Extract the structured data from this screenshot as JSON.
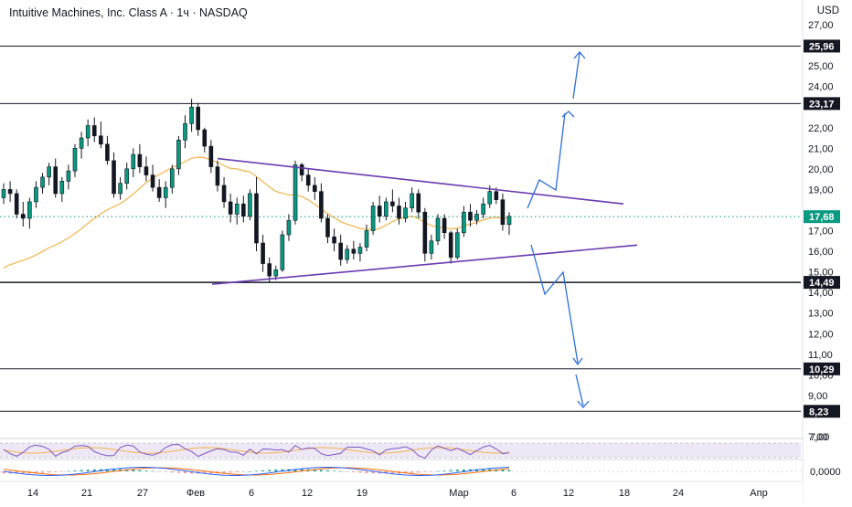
{
  "header": {
    "title": "Intuitive Machines, Inc. Class A · 1ч · NASDAQ",
    "currency": "USD"
  },
  "chart_data": {
    "type": "candlestick",
    "y_axis": {
      "range": [
        6.9,
        27.4
      ],
      "ticks": [
        "27,00",
        "25,00",
        "24,00",
        "22,00",
        "21,00",
        "20,00",
        "19,00",
        "17,00",
        "16,00",
        "15,00",
        "14,00",
        "13,00",
        "12,00",
        "11,00",
        "10,00",
        "9,00",
        "7,00"
      ],
      "tick_values": [
        27,
        25,
        24,
        22,
        21,
        20,
        19,
        17,
        16,
        15,
        14,
        13,
        12,
        11,
        10,
        9,
        7
      ]
    },
    "x_axis": {
      "labels": [
        "14",
        "21",
        "27",
        "Фев",
        "6",
        "12",
        "19",
        "Мар",
        "6",
        "12",
        "18",
        "24",
        "Апр"
      ]
    },
    "levels": [
      {
        "value": 25.96,
        "label": "25,96"
      },
      {
        "value": 23.17,
        "label": "23,17"
      },
      {
        "value": 14.49,
        "label": "14,49"
      },
      {
        "value": 10.29,
        "label": "10,29"
      },
      {
        "value": 8.23,
        "label": "8,23"
      }
    ],
    "last_price": {
      "value": 17.68,
      "label": "17,68",
      "color": "#089981"
    },
    "triangle": {
      "upper": [
        [
          0.0,
          20.5
        ],
        [
          1.0,
          18.3
        ]
      ],
      "lower": [
        [
          0.0,
          14.4
        ],
        [
          1.0,
          16.3
        ]
      ],
      "color": "#6a3ab0"
    },
    "scenarios": {
      "bullish": [
        [
          17.9
        ],
        [
          19.4
        ],
        [
          19.0
        ],
        [
          22.8
        ],
        [
          25.6
        ]
      ],
      "bearish": [
        [
          16.3
        ],
        [
          14.0
        ],
        [
          14.9
        ],
        [
          10.4
        ],
        [
          8.4
        ]
      ],
      "color": "#2d6fd8"
    },
    "moving_average_color": "#f2b449",
    "candles": [
      [
        18.6,
        19.3,
        18.3,
        19.0
      ],
      [
        19.0,
        19.4,
        18.4,
        18.8
      ],
      [
        18.8,
        19.0,
        17.6,
        17.8
      ],
      [
        17.8,
        18.4,
        17.2,
        17.6
      ],
      [
        17.6,
        18.6,
        17.1,
        18.4
      ],
      [
        18.4,
        19.4,
        18.1,
        19.1
      ],
      [
        19.1,
        19.8,
        18.8,
        19.6
      ],
      [
        19.6,
        20.3,
        19.2,
        20.1
      ],
      [
        20.1,
        20.5,
        18.6,
        18.8
      ],
      [
        18.8,
        19.6,
        18.4,
        19.4
      ],
      [
        19.4,
        20.2,
        19.0,
        19.9
      ],
      [
        19.9,
        21.2,
        19.6,
        21.0
      ],
      [
        21.0,
        21.8,
        20.5,
        21.5
      ],
      [
        21.5,
        22.4,
        21.1,
        22.1
      ],
      [
        22.1,
        22.5,
        21.3,
        21.6
      ],
      [
        21.6,
        22.3,
        21.0,
        21.2
      ],
      [
        21.2,
        21.6,
        20.2,
        20.4
      ],
      [
        20.4,
        20.8,
        18.6,
        18.8
      ],
      [
        18.8,
        19.6,
        18.5,
        19.3
      ],
      [
        19.3,
        20.3,
        19.0,
        20.0
      ],
      [
        20.0,
        21.0,
        19.6,
        20.7
      ],
      [
        20.7,
        21.2,
        19.8,
        20.1
      ],
      [
        20.1,
        20.6,
        19.4,
        19.7
      ],
      [
        19.7,
        20.2,
        18.9,
        19.1
      ],
      [
        19.1,
        19.5,
        18.4,
        18.6
      ],
      [
        18.6,
        19.4,
        18.1,
        19.1
      ],
      [
        19.1,
        20.2,
        18.8,
        20.0
      ],
      [
        20.0,
        21.6,
        19.7,
        21.4
      ],
      [
        21.4,
        22.6,
        21.0,
        22.2
      ],
      [
        22.2,
        23.4,
        21.8,
        23.0
      ],
      [
        23.0,
        23.2,
        21.6,
        21.9
      ],
      [
        21.9,
        22.0,
        20.8,
        21.1
      ],
      [
        21.1,
        21.4,
        19.8,
        20.1
      ],
      [
        20.1,
        20.4,
        18.9,
        19.2
      ],
      [
        19.2,
        19.6,
        18.1,
        18.4
      ],
      [
        18.4,
        18.8,
        17.4,
        17.8
      ],
      [
        17.8,
        18.6,
        17.3,
        18.3
      ],
      [
        18.3,
        18.7,
        17.4,
        17.7
      ],
      [
        17.7,
        19.0,
        17.5,
        18.8
      ],
      [
        18.8,
        19.6,
        16.0,
        16.4
      ],
      [
        16.4,
        16.8,
        15.0,
        15.4
      ],
      [
        15.4,
        15.7,
        14.5,
        14.8
      ],
      [
        14.8,
        15.3,
        14.6,
        15.1
      ],
      [
        15.1,
        17.0,
        15.0,
        16.8
      ],
      [
        16.8,
        17.8,
        16.5,
        17.5
      ],
      [
        17.5,
        20.4,
        17.3,
        20.2
      ],
      [
        20.2,
        20.3,
        19.4,
        19.7
      ],
      [
        19.7,
        20.0,
        18.9,
        19.2
      ],
      [
        19.2,
        19.6,
        18.5,
        18.9
      ],
      [
        18.9,
        19.3,
        17.4,
        17.6
      ],
      [
        17.6,
        17.8,
        16.4,
        16.7
      ],
      [
        16.7,
        17.1,
        16.0,
        16.4
      ],
      [
        16.4,
        16.8,
        15.3,
        15.6
      ],
      [
        15.6,
        16.3,
        15.4,
        16.1
      ],
      [
        16.1,
        16.5,
        15.6,
        15.9
      ],
      [
        15.9,
        16.4,
        15.5,
        16.2
      ],
      [
        16.2,
        17.3,
        16.0,
        17.0
      ],
      [
        17.0,
        18.4,
        16.8,
        18.2
      ],
      [
        18.2,
        18.7,
        17.4,
        17.7
      ],
      [
        17.7,
        18.6,
        17.5,
        18.4
      ],
      [
        18.4,
        19.0,
        17.9,
        18.2
      ],
      [
        18.2,
        18.6,
        17.3,
        17.6
      ],
      [
        17.6,
        18.4,
        17.4,
        18.1
      ],
      [
        18.1,
        19.1,
        17.9,
        18.8
      ],
      [
        18.8,
        19.0,
        17.6,
        17.9
      ],
      [
        17.9,
        18.1,
        15.5,
        15.9
      ],
      [
        15.9,
        16.8,
        15.6,
        16.5
      ],
      [
        16.5,
        17.8,
        16.3,
        17.6
      ],
      [
        17.6,
        17.8,
        16.6,
        16.9
      ],
      [
        16.9,
        17.0,
        15.4,
        15.7
      ],
      [
        15.7,
        17.1,
        15.6,
        16.9
      ],
      [
        16.9,
        18.2,
        16.7,
        17.9
      ],
      [
        17.9,
        18.3,
        17.2,
        17.5
      ],
      [
        17.5,
        18.0,
        17.3,
        17.8
      ],
      [
        17.8,
        18.6,
        17.6,
        18.3
      ],
      [
        18.3,
        19.2,
        18.1,
        18.9
      ],
      [
        18.9,
        19.1,
        18.3,
        18.5
      ],
      [
        18.5,
        18.8,
        17.0,
        17.3
      ],
      [
        17.3,
        17.9,
        16.8,
        17.7
      ]
    ],
    "title": "Intuitive Machines, Inc. Class A · 1ч · NASDAQ"
  },
  "indicators": {
    "oscillator_1": {
      "label": "7,00",
      "color": "#7e57c2",
      "band_color": "#ede7f6"
    },
    "oscillator_2": {
      "label": "0,0000",
      "macd_color": "#2962ff",
      "signal_color": "#ff6d00"
    }
  }
}
